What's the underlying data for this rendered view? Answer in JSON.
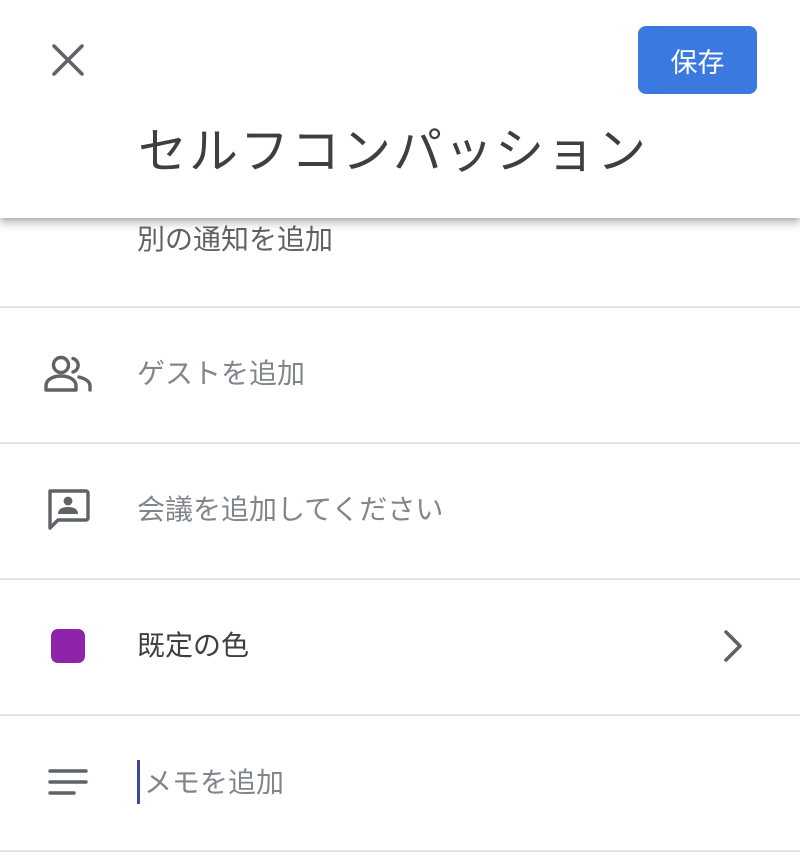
{
  "header": {
    "title": "セルフコンパッション",
    "save_label": "保存",
    "close_icon": "close-icon"
  },
  "rows": {
    "notification": {
      "label": "別の通知を追加"
    },
    "guests": {
      "label": "ゲストを追加",
      "icon": "people-icon"
    },
    "conference": {
      "label": "会議を追加してください",
      "icon": "video-chat-icon"
    },
    "color": {
      "label": "既定の色",
      "icon": "color-swatch",
      "swatch_color": "#8e24aa",
      "chevron": "chevron-right-icon"
    },
    "notes": {
      "placeholder": "メモを追加",
      "value": "",
      "icon": "notes-icon"
    }
  },
  "colors": {
    "accent": "#3a79e0",
    "text": "#3c4043",
    "muted": "#80868b",
    "divider": "#e3e3e6",
    "cursor": "#3c4a9e"
  }
}
